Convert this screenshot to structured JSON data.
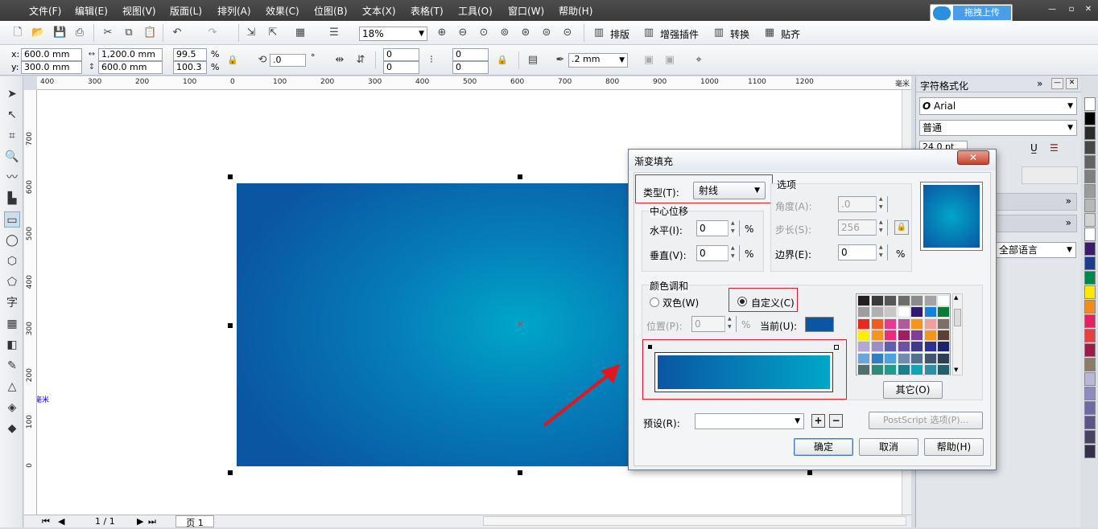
{
  "menu": [
    "文件(F)",
    "编辑(E)",
    "视图(V)",
    "版面(L)",
    "排列(A)",
    "效果(C)",
    "位图(B)",
    "文本(X)",
    "表格(T)",
    "工具(O)",
    "窗口(W)",
    "帮助(H)"
  ],
  "upload_label": "拖拽上传",
  "toolbar1": {
    "zoom": "18%",
    "layout_label": "排版",
    "plugin_label": "增强插件",
    "convert_label": "转换",
    "align_label": "贴齐"
  },
  "toolbar2": {
    "x_label": "x:",
    "y_label": "y:",
    "x": "600.0 mm",
    "y": "300.0 mm",
    "width": "1,200.0 mm",
    "height": "600.0 mm",
    "scale_x": "99.5",
    "scale_y": "100.3",
    "pct1": "%",
    "pct2": "%",
    "rotation": ".0",
    "deg": "°",
    "pos1": "0",
    "pos2": "0",
    "pos3": "0",
    "pos4": "0",
    "outline": ".2 mm"
  },
  "ruler_h": [
    "400",
    "300",
    "200",
    "100",
    "0",
    "100",
    "200",
    "300",
    "400",
    "500",
    "600",
    "700",
    "800",
    "900",
    "1000",
    "1100",
    "1200",
    "毫米"
  ],
  "ruler_v": [
    "700",
    "600",
    "500",
    "400",
    "300",
    "200",
    "100",
    "0"
  ],
  "ruler_v_unit": "毫米",
  "status": {
    "page_count": "1 / 1",
    "page_tab": "页 1"
  },
  "docker": {
    "title": "字符格式化",
    "font": "Arial",
    "style": "普通",
    "size": "24.0 pt",
    "lang": "全部语言"
  },
  "dialog": {
    "title": "渐变填充",
    "type_label": "类型(T):",
    "type_value": "射线",
    "options_label": "选项",
    "center_label": "中心位移",
    "horizontal_label": "水平(I):",
    "horizontal_value": "0",
    "vertical_label": "垂直(V):",
    "vertical_value": "0",
    "angle_label": "角度(A):",
    "angle_value": ".0",
    "steps_label": "步长(S):",
    "steps_value": "256",
    "edge_label": "边界(E):",
    "edge_value": "0",
    "blend_label": "颜色调和",
    "two_color_label": "双色(W)",
    "custom_label": "自定义(C)",
    "position_label": "位置(P):",
    "position_value": "0",
    "current_label": "当前(U):",
    "other_label": "其它(O)",
    "preset_label": "预设(R):",
    "postscript_label": "PostScript 选项(P)...",
    "ok_label": "确定",
    "cancel_label": "取消",
    "help_label": "帮助(H)",
    "pct": "%"
  },
  "colors": {
    "grad_start": "#0a56a2",
    "grad_end": "#00a6c8",
    "current": "#0a56a2"
  },
  "palette_swatches": [
    "#ffffff",
    "#000000",
    "#2b2b2b",
    "#474747",
    "#636363",
    "#7f7f7f",
    "#9b9b9b",
    "#b7b7b7",
    "#d3d3d3",
    "#ffffff",
    "#3c1b6b",
    "#1a3e8c",
    "#00874a",
    "#ffe800",
    "#f28c1e",
    "#e8205b",
    "#e84040",
    "#9b1b4b",
    "#8c7d6a",
    "#b9b6d6",
    "#8f8bc0",
    "#6f6aa4",
    "#5c5586",
    "#484360",
    "#353048"
  ],
  "dialog_palette": [
    "#231f20",
    "#3a3a3a",
    "#575757",
    "#6d6d6d",
    "#8a8a8a",
    "#a3a3a3",
    "#ffffff",
    "#9e9e9e",
    "#b0b0b0",
    "#c7c7c7",
    "#ffffff",
    "#2e1a6e",
    "#1582d8",
    "#0a7a3a",
    "#e82a1e",
    "#f05a23",
    "#e8398f",
    "#b05a9a",
    "#f7941d",
    "#f29fa0",
    "#7d6f66",
    "#ffee00",
    "#f7941d",
    "#ee2a7b",
    "#9e1f63",
    "#7e3f98",
    "#f7941d",
    "#5c4033",
    "#b3a8d3",
    "#9b8ec4",
    "#5f5fae",
    "#6d52a3",
    "#3f3a8a",
    "#2e3192",
    "#1c2470",
    "#6ea5d9",
    "#2f7fc1",
    "#4aa3df",
    "#6f8ca8",
    "#52718f",
    "#3f5570",
    "#2f3f52",
    "#4f6f6f",
    "#2e8b7a",
    "#1f9c8c",
    "#1b7f8c",
    "#13a3b8",
    "#2f8fa0",
    "#23606a"
  ]
}
